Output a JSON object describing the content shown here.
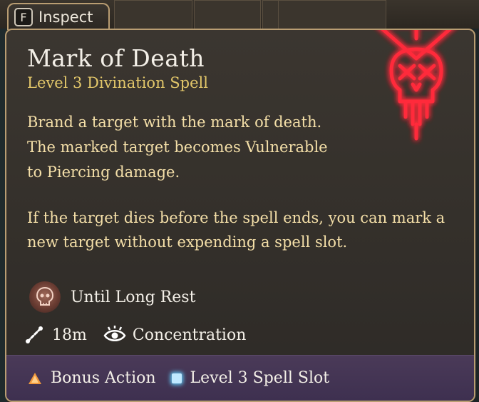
{
  "inspect_tab": {
    "key": "F",
    "label": "Inspect"
  },
  "spell": {
    "name": "Mark of Death",
    "subtitle": "Level 3 Divination Spell",
    "description_1": "Brand a target with the mark of death. The marked target becomes Vulnerable to Piercing damage.",
    "description_2": "If the target dies before the spell ends, you can mark a new target without expending a spell slot."
  },
  "duration": {
    "icon": "skull-rest-icon",
    "label": "Until Long Rest"
  },
  "range": {
    "icon": "range-icon",
    "label": "18m"
  },
  "concentration": {
    "icon": "concentration-icon",
    "label": "Concentration"
  },
  "footer": {
    "action": {
      "icon": "bonus-action-triangle-icon",
      "label": "Bonus Action",
      "color": "#f29a3c"
    },
    "cost": {
      "icon": "spell-slot-icon",
      "label": "Level 3 Spell Slot",
      "color": "#5fc4f0"
    }
  },
  "colors": {
    "frame": "#b99d72",
    "title": "#f3efe7",
    "subtitle": "#e3c76a",
    "description": "#f4dfa8",
    "skull_glow": "#ff2a3a",
    "footer_bg": "#45355a"
  }
}
